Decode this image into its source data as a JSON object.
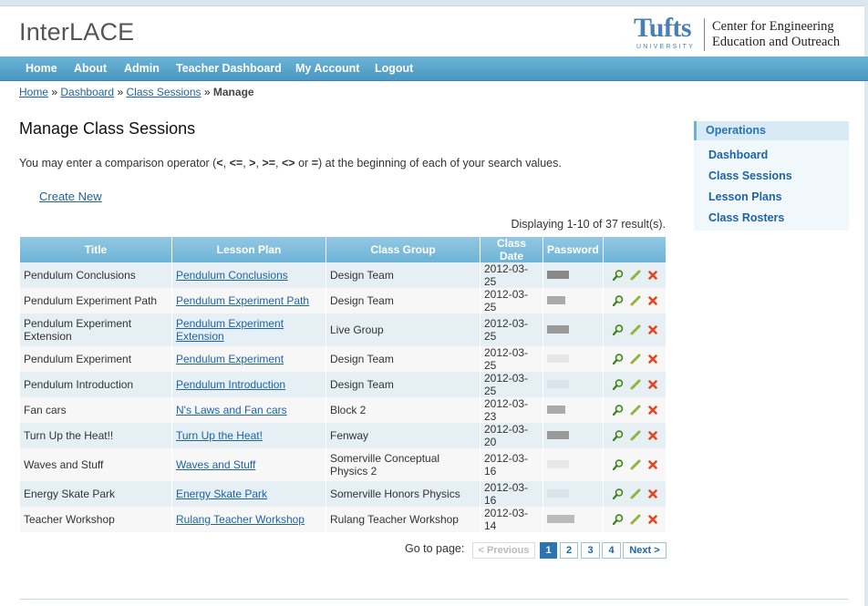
{
  "app": {
    "title": "InterLACE"
  },
  "logo": {
    "tufts": "Tufts",
    "university": "UNIVERSITY",
    "line1": "Center for Engineering",
    "line2": "Education and Outreach"
  },
  "nav": {
    "items": [
      "Home",
      "About",
      "Admin",
      "Teacher Dashboard",
      "My Account",
      "Logout"
    ]
  },
  "breadcrumb": {
    "home": "Home",
    "sep1": "»",
    "dashboard": "Dashboard",
    "sep2": "»",
    "class_sessions": "Class Sessions",
    "sep3": "»",
    "current": "Manage"
  },
  "page": {
    "title": "Manage Class Sessions",
    "hint_pre": "You may enter a comparison operator (",
    "ops": [
      "<",
      "<=",
      ">",
      ">=",
      "<>"
    ],
    "hint_or": "or",
    "op_last": "=",
    "hint_post": ") at the beginning of each of your search values.",
    "create_new": "Create New",
    "summary": "Displaying 1-10 of 37 result(s)."
  },
  "table": {
    "columns": [
      "Title",
      "Lesson Plan",
      "Class Group",
      "Class Date",
      "Password",
      ""
    ],
    "rows": [
      {
        "title": "Pendulum Conclusions",
        "lesson_plan": "Pendulum Conclusions",
        "class_group": "Design Team",
        "date": "2012-03-25"
      },
      {
        "title": "Pendulum Experiment Path",
        "lesson_plan": "Pendulum Experiment Path",
        "class_group": "Design Team",
        "date": "2012-03-25"
      },
      {
        "title": "Pendulum Experiment Extension",
        "lesson_plan": "Pendulum Experiment Extension",
        "class_group": "Live Group",
        "date": "2012-03-25"
      },
      {
        "title": "Pendulum Experiment",
        "lesson_plan": "Pendulum Experiment",
        "class_group": "Design Team",
        "date": "2012-03-25"
      },
      {
        "title": "Pendulum Introduction",
        "lesson_plan": "Pendulum Introduction",
        "class_group": "Design Team",
        "date": "2012-03-25"
      },
      {
        "title": "Fan cars",
        "lesson_plan": "N's Laws and Fan cars",
        "class_group": "Block 2",
        "date": "2012-03-23"
      },
      {
        "title": "Turn Up the Heat!!",
        "lesson_plan": "Turn Up the Heat!",
        "class_group": "Fenway",
        "date": "2012-03-20"
      },
      {
        "title": "Waves and Stuff",
        "lesson_plan": "Waves and Stuff",
        "class_group": "Somerville Conceptual Physics 2",
        "date": "2012-03-16"
      },
      {
        "title": "Energy Skate Park",
        "lesson_plan": "Energy Skate Park",
        "class_group": "Somerville Honors Physics",
        "date": "2012-03-16"
      },
      {
        "title": "Teacher Workshop",
        "lesson_plan": "Rulang Teacher Workshop",
        "class_group": "Rulang Teacher Workshop",
        "date": "2012-03-14"
      }
    ],
    "row_actions": [
      "view-icon",
      "edit-icon",
      "delete-icon"
    ]
  },
  "pager": {
    "label": "Go to page:",
    "prev": "< Previous",
    "pages": [
      "1",
      "2",
      "3",
      "4"
    ],
    "current": "1",
    "next": "Next >"
  },
  "sidebar": {
    "title": "Operations",
    "items": [
      "Dashboard",
      "Class Sessions",
      "Lesson Plans",
      "Class Rosters"
    ]
  },
  "colors": {
    "nav": "#4a97c3",
    "link": "#1d63a8",
    "header_cell": "#6eb3d6",
    "row_odd": "#e6eff4",
    "row_even": "#f7f7f7",
    "sidebar_bg": "#f1f8fc"
  }
}
